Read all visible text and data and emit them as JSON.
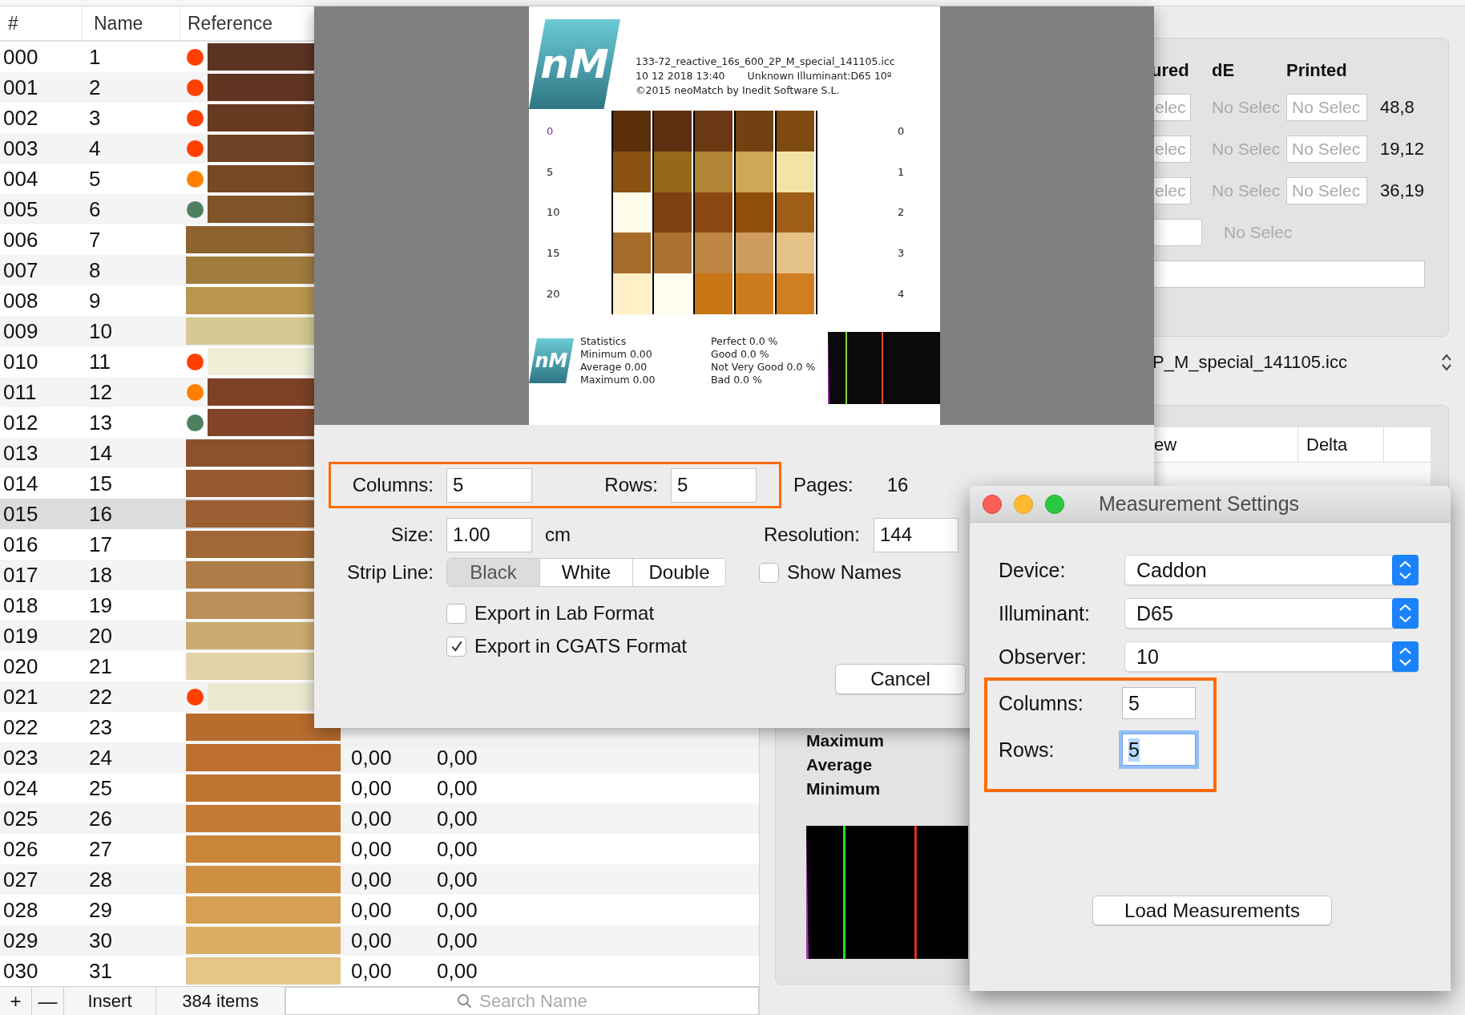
{
  "table": {
    "columns": [
      "#",
      "Name",
      "Reference"
    ],
    "rows": [
      {
        "number": "000",
        "name": "1",
        "dot": {
          "color": "#ff4000"
        },
        "swatch": {
          "color": "#5c3322"
        },
        "selected": false
      },
      {
        "number": "001",
        "name": "2",
        "dot": {
          "color": "#ff4000"
        },
        "swatch": {
          "color": "#613521"
        },
        "selected": false
      },
      {
        "number": "002",
        "name": "3",
        "dot": {
          "color": "#ff4000"
        },
        "swatch": {
          "color": "#673a22"
        },
        "selected": false
      },
      {
        "number": "003",
        "name": "4",
        "dot": {
          "color": "#ff4000"
        },
        "swatch": {
          "color": "#6e4224"
        },
        "selected": false
      },
      {
        "number": "004",
        "name": "5",
        "dot": {
          "color": "#ff8000"
        },
        "swatch": {
          "color": "#774a26"
        },
        "selected": false
      },
      {
        "number": "005",
        "name": "6",
        "dot": {
          "color": "#4e8060"
        },
        "swatch": {
          "color": "#7f5429"
        },
        "selected": false
      },
      {
        "number": "006",
        "name": "7",
        "swatch": {
          "color": "#8d6330"
        },
        "selected": false
      },
      {
        "number": "007",
        "name": "8",
        "swatch": {
          "color": "#a07c3d"
        },
        "selected": false
      },
      {
        "number": "008",
        "name": "9",
        "swatch": {
          "color": "#b9954f"
        },
        "selected": false
      },
      {
        "number": "009",
        "name": "10",
        "swatch": {
          "color": "#d6c991"
        },
        "selected": false
      },
      {
        "number": "010",
        "name": "11",
        "dot": {
          "color": "#ff4000"
        },
        "swatch": {
          "color": "#eeeed6"
        },
        "selected": false
      },
      {
        "number": "011",
        "name": "12",
        "dot": {
          "color": "#ff8000"
        },
        "swatch": {
          "color": "#7d4226"
        },
        "selected": false
      },
      {
        "number": "012",
        "name": "13",
        "dot": {
          "color": "#4e8060"
        },
        "swatch": {
          "color": "#82452a"
        },
        "selected": false
      },
      {
        "number": "013",
        "name": "14",
        "swatch": {
          "color": "#8c522e"
        },
        "selected": false
      },
      {
        "number": "014",
        "name": "15",
        "swatch": {
          "color": "#955a30"
        },
        "selected": false
      },
      {
        "number": "015",
        "name": "16",
        "swatch": {
          "color": "#9a6033"
        },
        "selected": true
      },
      {
        "number": "016",
        "name": "17",
        "swatch": {
          "color": "#a06838"
        },
        "selected": false
      },
      {
        "number": "017",
        "name": "18",
        "swatch": {
          "color": "#ae7d48"
        },
        "selected": false
      },
      {
        "number": "018",
        "name": "19",
        "swatch": {
          "color": "#bb9058"
        },
        "selected": false
      },
      {
        "number": "019",
        "name": "20",
        "swatch": {
          "color": "#ccab72"
        },
        "selected": false
      },
      {
        "number": "020",
        "name": "21",
        "swatch": {
          "color": "#e2d3a8"
        },
        "selected": false
      },
      {
        "number": "021",
        "name": "22",
        "dot": {
          "color": "#ff4000"
        },
        "swatch": {
          "color": "#ebe8d2"
        },
        "selected": false
      },
      {
        "number": "022",
        "name": "23",
        "swatch": {
          "color": "#b86c2e"
        },
        "selected": false
      },
      {
        "number": "023",
        "name": "24",
        "swatch": {
          "color": "#bc6f2f"
        },
        "values": [
          "0,00",
          "0,00"
        ],
        "selected": false
      },
      {
        "number": "024",
        "name": "25",
        "swatch": {
          "color": "#c07431"
        },
        "values": [
          "0,00",
          "0,00"
        ],
        "selected": false
      },
      {
        "number": "025",
        "name": "26",
        "swatch": {
          "color": "#c47a34"
        },
        "values": [
          "0,00",
          "0,00"
        ],
        "selected": false
      },
      {
        "number": "026",
        "name": "27",
        "swatch": {
          "color": "#c9853a"
        },
        "values": [
          "0,00",
          "0,00"
        ],
        "selected": false
      },
      {
        "number": "027",
        "name": "28",
        "swatch": {
          "color": "#cf8f42"
        },
        "values": [
          "0,00",
          "0,00"
        ],
        "selected": false
      },
      {
        "number": "028",
        "name": "29",
        "swatch": {
          "color": "#d5a055"
        },
        "values": [
          "0,00",
          "0,00"
        ],
        "selected": false
      },
      {
        "number": "029",
        "name": "30",
        "swatch": {
          "color": "#dbae65"
        },
        "values": [
          "0,00",
          "0,00"
        ],
        "selected": false
      },
      {
        "number": "030",
        "name": "31",
        "swatch": {
          "color": "#e4c787"
        },
        "values": [
          "0,00",
          "0,00"
        ],
        "selected": false
      }
    ],
    "footer": {
      "buttons": [
        "+",
        "—",
        "Insert"
      ],
      "count": "384 items",
      "search": {
        "placeholder": "Search Name"
      }
    }
  },
  "background_panel": {
    "headers": [
      "ured",
      "dE",
      "Printed"
    ],
    "rows": [
      {
        "measured_placeholder": "elec",
        "de": "No Selec",
        "printed_placeholder": "No Selec",
        "value": "48,8"
      },
      {
        "measured_placeholder": "elec",
        "de": "No Selec",
        "printed_placeholder": "No Selec",
        "value": "19,12"
      },
      {
        "measured_placeholder": "elec",
        "de": "No Selec",
        "printed_placeholder": "No Selec",
        "value": "36,19"
      }
    ],
    "summary": {
      "de": "No Selec"
    },
    "profile": "P_M_special_141105.icc",
    "results": {
      "columns": [
        "ew",
        "Delta"
      ],
      "stats": [
        "Maximum",
        "Average",
        "Minimum"
      ]
    }
  },
  "export_sheet": {
    "preview": {
      "logo": "nM",
      "file": "133-72_reactive_16s_600_2P_M_special_141105.icc",
      "date": "10 12 2018 13:40",
      "illuminant": "Unknown Illuminant:D65 10º",
      "copyright": "©2015 neoMatch by Inedit Software S.L.",
      "row_labels": [
        {
          "label": "0",
          "highlighted": true
        },
        {
          "label": "5",
          "highlighted": false
        },
        {
          "label": "10",
          "highlighted": false
        },
        {
          "label": "15",
          "highlighted": false
        },
        {
          "label": "20",
          "highlighted": false
        }
      ],
      "right_labels": [
        "0",
        "1",
        "2",
        "3",
        "4"
      ],
      "patches": [
        [
          {
            "color": "#5b2e0c"
          },
          {
            "color": "#5e2f10"
          },
          {
            "color": "#6a3813"
          },
          {
            "color": "#714111"
          },
          {
            "color": "#7e4a10"
          }
        ],
        [
          {
            "color": "#8a5212"
          },
          {
            "color": "#97681a"
          },
          {
            "color": "#b08535"
          },
          {
            "color": "#cda858"
          },
          {
            "color": "#f4e3a6"
          }
        ],
        [
          {
            "color": "#fffbe9"
          },
          {
            "color": "#7f4014"
          },
          {
            "color": "#8a4711"
          },
          {
            "color": "#8f4e0b"
          },
          {
            "color": "#9e5e18"
          }
        ],
        [
          {
            "color": "#a66b28"
          },
          {
            "color": "#ac712f"
          },
          {
            "color": "#bd8642"
          },
          {
            "color": "#cd9c5e"
          },
          {
            "color": "#e3c187"
          }
        ],
        [
          {
            "color": "#fff0c8"
          },
          {
            "color": "#fffdf0"
          },
          {
            "color": "#c77515"
          },
          {
            "color": "#cb7a1d"
          },
          {
            "color": "#cf7e20"
          }
        ]
      ],
      "stats_logo": "nM",
      "statistics": [
        "Statistics",
        "Minimum 0.00",
        "Average 0.00",
        "Maximum 0.00"
      ],
      "ratings": [
        "Perfect 0.0 %",
        "Good 0.0 %",
        "Not Very Good 0.0 %",
        "Bad 0.0 %"
      ]
    },
    "controls": {
      "grid_size": {
        "annotated": true,
        "fields": [
          {
            "label": "Columns:",
            "value": "5"
          },
          {
            "label": "Rows:",
            "value": "5"
          }
        ]
      },
      "pages": {
        "label": "Pages:",
        "value": "16"
      },
      "size": {
        "label": "Size:",
        "value": "1.00",
        "unit": "cm"
      },
      "resolution": {
        "label": "Resolution:",
        "value": "144"
      },
      "strip_line": {
        "label": "Strip Line:",
        "options": [
          {
            "label": "Black",
            "selected": true
          },
          {
            "label": "White",
            "selected": false
          },
          {
            "label": "Double",
            "selected": false
          }
        ]
      },
      "show_names": {
        "label": "Show Names",
        "checked": false
      },
      "exports": [
        {
          "label": "Export in Lab Format",
          "checked": false
        },
        {
          "label": "Export in CGATS Format",
          "checked": true
        }
      ],
      "cancel": "Cancel"
    }
  },
  "measurement_window": {
    "title": "Measurement Settings",
    "popups": [
      {
        "label": "Device:",
        "value": "Caddon"
      },
      {
        "label": "Illuminant:",
        "value": "D65"
      },
      {
        "label": "Observer:",
        "value": "10"
      }
    ],
    "grid_size": {
      "annotated": true,
      "fields": [
        {
          "label": "Columns:",
          "value": "5",
          "focused": false
        },
        {
          "label": "Rows:",
          "value": "5",
          "focused": true
        }
      ]
    },
    "button": "Load Measurements"
  }
}
